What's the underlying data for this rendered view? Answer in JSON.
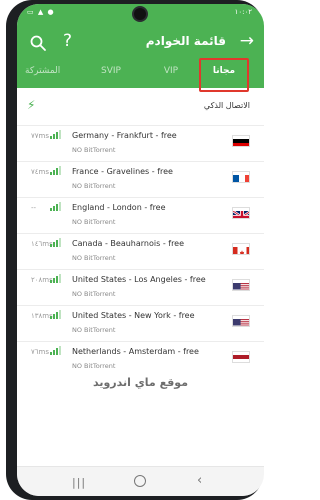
{
  "status": {
    "time": "١٠:٠٢",
    "icons": "▭ ▲ ●"
  },
  "header": {
    "title": "قائمة الخوادم",
    "help": "?",
    "back": "→"
  },
  "tabs": [
    {
      "label": "المشتركة"
    },
    {
      "label": "SVIP"
    },
    {
      "label": "VIP"
    },
    {
      "label": "مجانا"
    }
  ],
  "smart": {
    "label": "الاتصال الذكي"
  },
  "servers": [
    {
      "ping": "٧٧ms",
      "name": "Germany - Frankfurt - free",
      "sub": "NO BitTorrent",
      "flag": "de"
    },
    {
      "ping": "٧٤ms",
      "name": "France - Gravelines - free",
      "sub": "NO BitTorrent",
      "flag": "fr"
    },
    {
      "ping": "--",
      "name": "England - London - free",
      "sub": "NO BitTorrent",
      "flag": "gb"
    },
    {
      "ping": "١٤٦ms",
      "name": "Canada - Beauharnois - free",
      "sub": "NO BitTorrent",
      "flag": "ca"
    },
    {
      "ping": "٢٠٨ms",
      "name": "United States - Los Angeles - free",
      "sub": "NO BitTorrent",
      "flag": "us"
    },
    {
      "ping": "١٣٨ms",
      "name": "United States - New York - free",
      "sub": "NO BitTorrent",
      "flag": "us"
    },
    {
      "ping": "٧٦ms",
      "name": "Netherlands - Amsterdam - free",
      "sub": "NO BitTorrent",
      "flag": "nl"
    }
  ],
  "watermark": "موقع ماي اندرويد",
  "colors": {
    "primary": "#4cb253",
    "highlight": "#e0382c"
  }
}
